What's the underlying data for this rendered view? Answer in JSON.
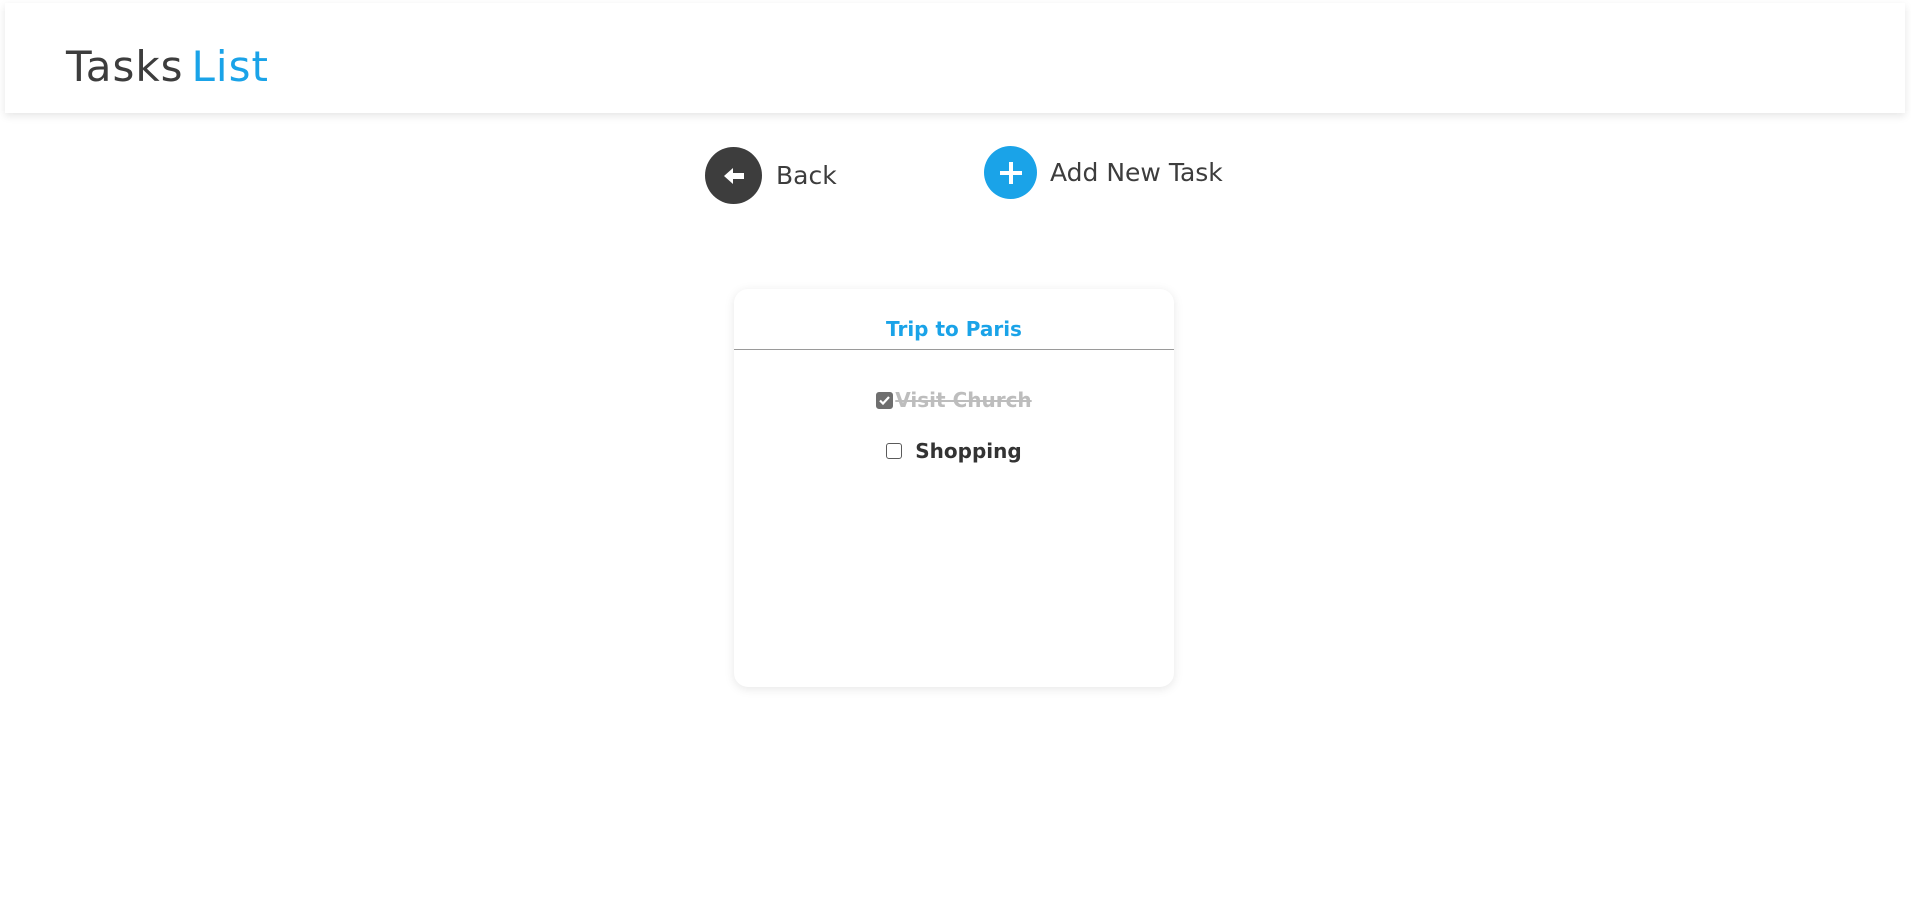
{
  "header": {
    "title_part1": "Tasks",
    "title_part2": "List",
    "accent_color": "#1aa3e8",
    "text_color": "#3d3d3d"
  },
  "actions": {
    "back": {
      "label": "Back",
      "icon": "arrow-left-icon"
    },
    "add": {
      "label": "Add New Task",
      "icon": "plus-icon"
    }
  },
  "list": {
    "title": "Trip to Paris",
    "tasks": [
      {
        "label": "Visit Church",
        "done": true
      },
      {
        "label": "Shopping",
        "done": false
      }
    ]
  }
}
